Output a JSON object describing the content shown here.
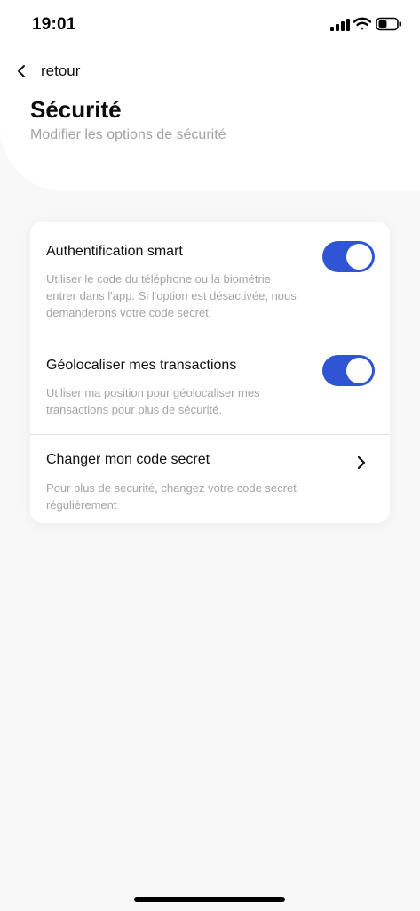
{
  "status_bar": {
    "time": "19:01",
    "icons": [
      "signal-icon",
      "wifi-icon",
      "battery-icon"
    ]
  },
  "header": {
    "back_label": "retour",
    "title": "Sécurité",
    "subtitle": "Modifier les options de sécurité"
  },
  "settings": [
    {
      "title": "Authentification smart",
      "description": "Utiliser le code du téléphone ou la biométrie entrer dans l'app. Si l'option est désactivée, nous demanderons votre code secret.",
      "control": "toggle",
      "enabled": true
    },
    {
      "title": "Géolocaliser mes transactions",
      "description": "Utiliser ma position pour géolocaliser mes transactions pour plus de sécurité.",
      "control": "toggle",
      "enabled": true
    },
    {
      "title": "Changer mon code secret",
      "description": "Pour plus de securité, changez votre code secret régulièrement",
      "control": "chevron-right-icon"
    }
  ],
  "colors": {
    "toggle_on": "#2f55d4",
    "background": "#f8f8f8",
    "card": "#ffffff",
    "muted_text": "#a5a5a5"
  }
}
